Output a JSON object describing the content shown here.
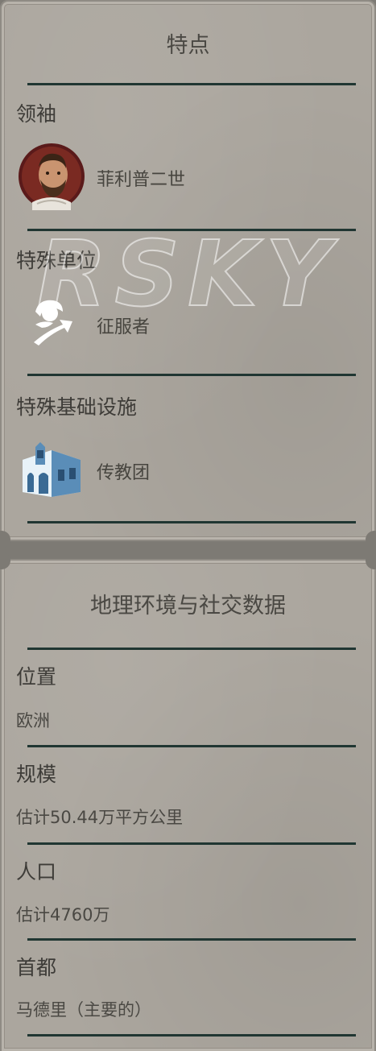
{
  "panel_features": {
    "title": "特点",
    "leader": {
      "label": "领袖",
      "name": "菲利普二世",
      "icon": "leader-portrait-icon"
    },
    "unit": {
      "label": "特殊单位",
      "name": "征服者",
      "icon": "conquistador-icon"
    },
    "building": {
      "label": "特殊基础设施",
      "name": "传教团",
      "icon": "mission-building-icon"
    }
  },
  "watermark": "RSKY",
  "panel_geo": {
    "title": "地理环境与社交数据",
    "location": {
      "label": "位置",
      "value": "欧洲"
    },
    "size": {
      "label": "规模",
      "value": "估计50.44万平方公里"
    },
    "population": {
      "label": "人口",
      "value": "估计4760万"
    },
    "capital": {
      "label": "首都",
      "value": "马德里（主要的）"
    }
  },
  "colors": {
    "panel_bg": "#aba69e",
    "rule": "#203632",
    "text": "#3e3c38"
  }
}
